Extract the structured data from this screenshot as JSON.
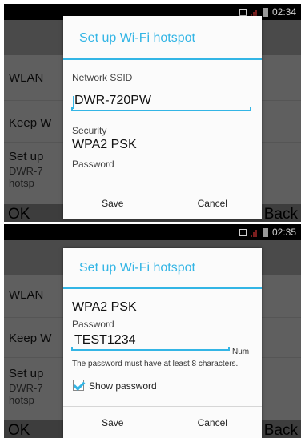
{
  "status_top": {
    "time": "02:34"
  },
  "status_bottom": {
    "time": "02:35"
  },
  "background": {
    "wlan": "WLAN",
    "keep": "Keep W",
    "setup": "Set up",
    "setup_sub1": "DWR-7",
    "setup_sub2": "hotsp",
    "ok": "OK",
    "back": "Back"
  },
  "dialog1": {
    "title": "Set up Wi-Fi hotspot",
    "ssid_label": "Network SSID",
    "ssid_value": "DWR-720PW",
    "security_label": "Security",
    "security_value": "WPA2 PSK",
    "password_label": "Password",
    "save": "Save",
    "cancel": "Cancel"
  },
  "dialog2": {
    "title": "Set up Wi-Fi hotspot",
    "security_value": "WPA2 PSK",
    "password_label": "Password",
    "password_value": "TEST1234",
    "password_suffix": "Num",
    "hint": "The password must have at least 8 characters.",
    "show_password": "Show password",
    "save": "Save",
    "cancel": "Cancel"
  },
  "colors": {
    "accent": "#33b5e5"
  }
}
